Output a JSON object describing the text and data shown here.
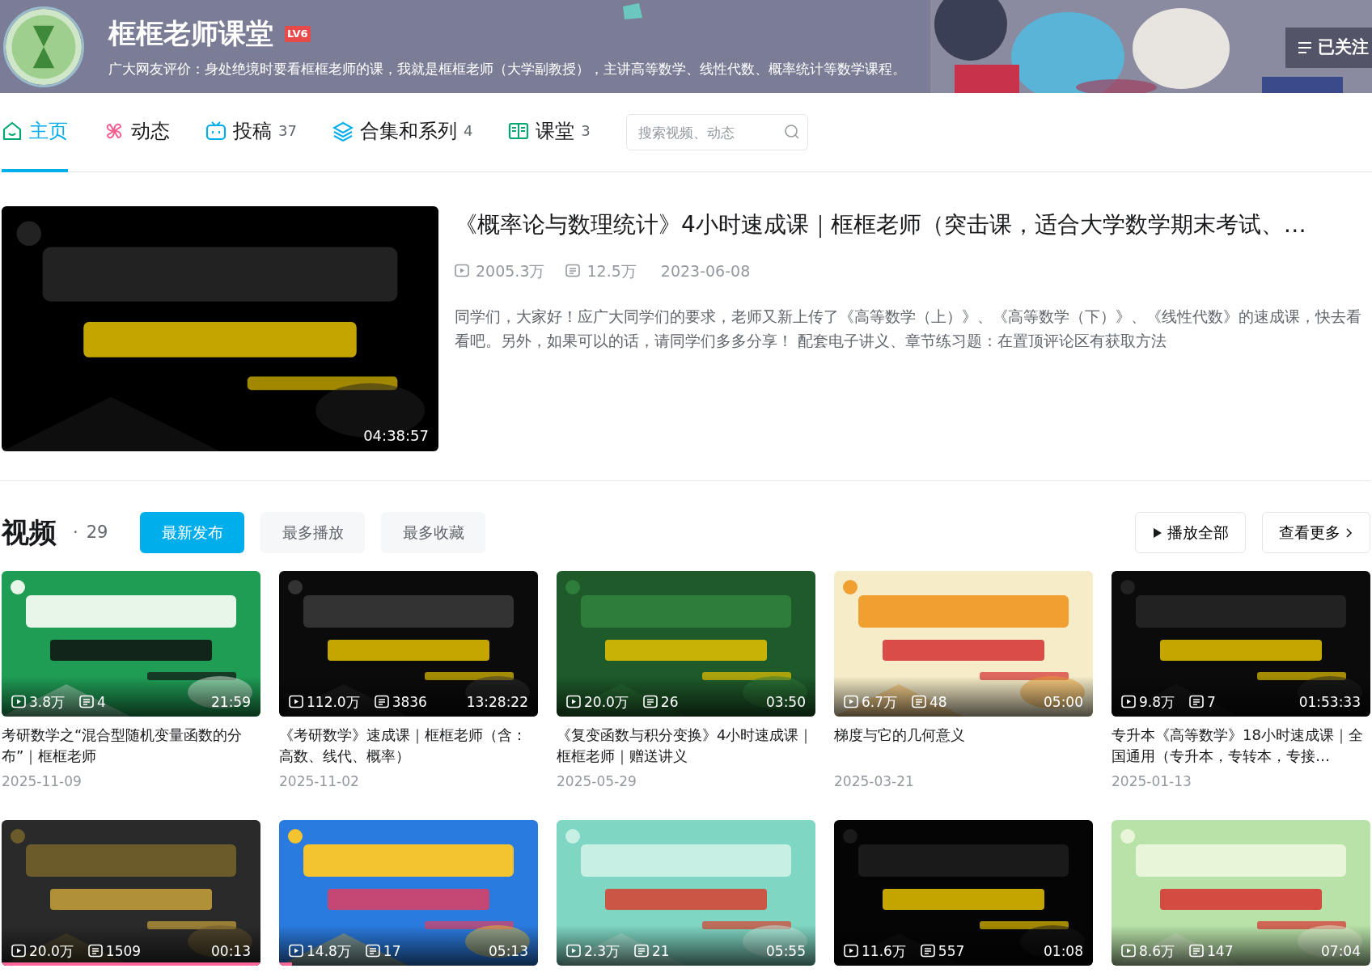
{
  "profile": {
    "name": "框框老师课堂",
    "level": "LV6",
    "bio": "广大网友评价：身处绝境时要看框框老师的课，我就是框框老师（大学副教授），主讲高等数学、线性代数、概率统计等数学课程。",
    "follow_button": "已关注"
  },
  "tabs": [
    {
      "label": "主页",
      "selected": true
    },
    {
      "label": "动态",
      "selected": false
    },
    {
      "label": "投稿",
      "count": "37",
      "selected": false
    },
    {
      "label": "合集和系列",
      "count": "4",
      "selected": false
    },
    {
      "label": "课堂",
      "count": "3",
      "selected": false
    }
  ],
  "search": {
    "placeholder": "搜索视频、动态"
  },
  "featured": {
    "title": "《概率论与数理统计》4小时速成课｜框框老师（突击课，适合大学数学期末考试、…",
    "plays": "2005.3万",
    "comments": "12.5万",
    "date": "2023-06-08",
    "description": "同学们，大家好！应广大同学们的要求，老师又新上传了《高等数学（上）》、《高等数学（下）》、《线性代数》的速成课，快去看看吧。另外，如果可以的话，请同学们多多分享！ 配套电子讲义、章节练习题：在置顶评论区有获取方法",
    "duration": "04:38:57"
  },
  "videos": {
    "heading": "视频",
    "count_separator": "·",
    "count": "29",
    "sort_tabs": [
      {
        "label": "最新发布",
        "selected": true
      },
      {
        "label": "最多播放",
        "selected": false
      },
      {
        "label": "最多收藏",
        "selected": false
      }
    ],
    "play_all_button": "播放全部",
    "more_button": "查看更多",
    "items": [
      {
        "plays": "3.8万",
        "comments": "4",
        "duration": "21:59",
        "title": "考研数学之“混合型随机变量函数的分布”｜框框老师",
        "date": "2025-11-09"
      },
      {
        "plays": "112.0万",
        "comments": "3836",
        "duration": "13:28:22",
        "title": "《考研数学》速成课｜框框老师（含：高数、线代、概率）",
        "date": "2025-11-02"
      },
      {
        "plays": "20.0万",
        "comments": "26",
        "duration": "03:50",
        "title": "《复变函数与积分变换》4小时速成课｜框框老师｜赠送讲义",
        "date": "2025-05-29"
      },
      {
        "plays": "6.7万",
        "comments": "48",
        "duration": "05:00",
        "title": "梯度与它的几何意义",
        "date": "2025-03-21"
      },
      {
        "plays": "9.8万",
        "comments": "7",
        "duration": "01:53:33",
        "title": "专升本《高等数学》18小时速成课｜全国通用（专升本，专转本，专接…",
        "date": "2025-01-13"
      },
      {
        "plays": "20.0万",
        "comments": "1509",
        "duration": "00:13",
        "level": 1
      },
      {
        "plays": "14.8万",
        "comments": "17",
        "duration": "05:13",
        "level": 0.05
      },
      {
        "plays": "2.3万",
        "comments": "21",
        "duration": "05:55"
      },
      {
        "plays": "11.6万",
        "comments": "557",
        "duration": "01:08"
      },
      {
        "plays": "8.6万",
        "comments": "147",
        "duration": "07:04"
      }
    ]
  }
}
